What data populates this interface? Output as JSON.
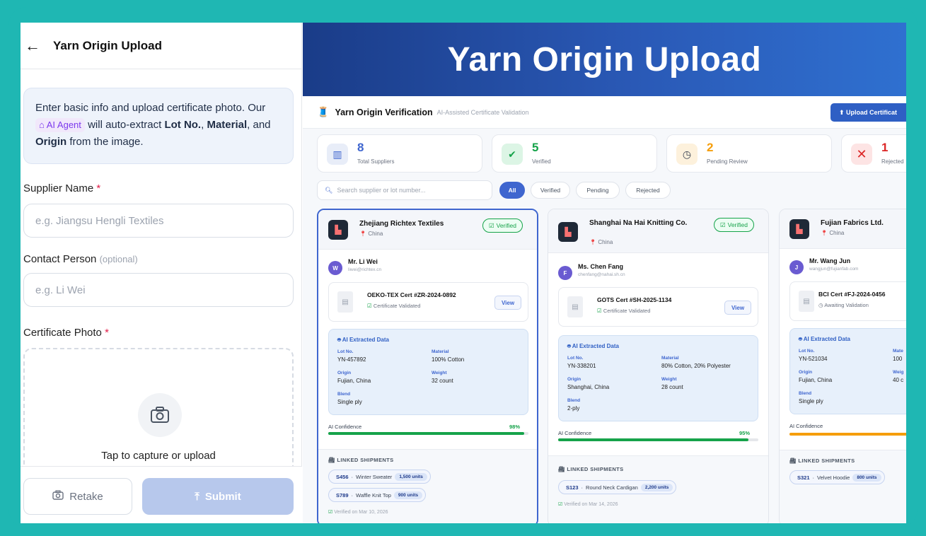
{
  "mobile": {
    "title": "Yarn Origin Upload",
    "info_part1": "Enter basic info and upload certificate photo. Our",
    "ai_agent": "AI Agent",
    "info_part2": "will auto-extract",
    "lot": "Lot No.",
    "material": "Material",
    "and": ", and",
    "origin": "Origin",
    "info_part3": "from the image.",
    "supplier_label": "Supplier Name",
    "supplier_placeholder": "e.g. Jiangsu Hengli Textiles",
    "contact_label": "Contact Person",
    "optional": "(optional)",
    "contact_placeholder": "e.g. Li Wei",
    "photo_label": "Certificate Photo",
    "upload_text": "Tap to capture or upload",
    "retake": "Retake",
    "submit": "Submit"
  },
  "banner": {
    "title": "Yarn Origin Upload"
  },
  "dashboard": {
    "title": "Yarn Origin Verification",
    "subtitle": "AI-Assisted Certificate Validation",
    "upload_button": "Upload Certificat",
    "stats": [
      {
        "value": "8",
        "label": "Total Suppliers",
        "color": "#3f66cf"
      },
      {
        "value": "5",
        "label": "Verified",
        "color": "#16a34a"
      },
      {
        "value": "2",
        "label": "Pending Review",
        "color": "#f59e0b"
      },
      {
        "value": "1",
        "label": "Rejected",
        "color": "#dc2626"
      }
    ],
    "search_placeholder": "Search supplier or lot number...",
    "filters": [
      "All",
      "Verified",
      "Pending",
      "Rejected"
    ],
    "cards": [
      {
        "name": "Zhejiang Richtex Textiles",
        "location": "China",
        "badge": "Verified",
        "initial": "W",
        "contact": "Mr. Li Wei",
        "email": "liwei@richtex.cn",
        "cert": "OEKO-TEX Cert #ZR-2024-0892",
        "cert_status": "Certificate Validated",
        "view": "View",
        "ai_title": "AI Extracted Data",
        "lot_k": "Lot No.",
        "lot": "YN-457892",
        "mat_k": "Material",
        "mat": "100% Cotton",
        "origin_k": "Origin",
        "origin": "Fujian, China",
        "weight_k": "Weight",
        "weight": "32 count",
        "blend_k": "Blend",
        "blend": "Single ply",
        "conf_label": "AI Confidence",
        "confidence": "98%",
        "confidence_value": 0.98,
        "ship_title": "LINKED SHIPMENTS",
        "shipments": [
          {
            "id": "S456",
            "desc": "Winter Sweater",
            "units": "1,500 units"
          },
          {
            "id": "S789",
            "desc": "Waffle Knit Top",
            "units": "900 units"
          }
        ],
        "verified_on": "Verified on Mar 10, 2026"
      },
      {
        "name": "Shanghai Na Hai Knitting Co.",
        "location": "China",
        "badge": "Verified",
        "initial": "F",
        "contact": "Ms. Chen Fang",
        "email": "chenfang@nahai.sh.cn",
        "cert": "GOTS Cert #SH-2025-1134",
        "cert_status": "Certificate Validated",
        "view": "View",
        "ai_title": "AI Extracted Data",
        "lot_k": "Lot No.",
        "lot": "YN-338201",
        "mat_k": "Material",
        "mat": "80% Cotton, 20% Polyester",
        "origin_k": "Origin",
        "origin": "Shanghai, China",
        "weight_k": "Weight",
        "weight": "28 count",
        "blend_k": "Blend",
        "blend": "2-ply",
        "conf_label": "AI Confidence",
        "confidence": "95%",
        "confidence_value": 0.95,
        "ship_title": "LINKED SHIPMENTS",
        "shipments": [
          {
            "id": "S123",
            "desc": "Round Neck Cardigan",
            "units": "2,200 units"
          }
        ],
        "verified_on": "Verified on Mar 14, 2026"
      },
      {
        "name": "Fujian Fabrics Ltd.",
        "location": "China",
        "initial": "J",
        "contact": "Mr. Wang Jun",
        "email": "wangjun@fujianfab.com",
        "cert": "BCI Cert #FJ-2024-0456",
        "cert_status": "Awaiting Validation",
        "ai_title": "AI Extracted Data",
        "lot_k": "Lot No.",
        "lot": "YN-521034",
        "mat_k": "Mate",
        "mat": "100",
        "origin_k": "Origin",
        "origin": "Fujian, China",
        "weight_k": "Weig",
        "weight": "40 c",
        "blend_k": "Blend",
        "blend": "Single ply",
        "conf_label": "AI Confidence",
        "confidence_value": 0.8,
        "ship_title": "LINKED SHIPMENTS",
        "shipments": [
          {
            "id": "S321",
            "desc": "Velvet Hoodie",
            "units": "800 units"
          }
        ]
      }
    ]
  },
  "colors": {
    "banner": "#2a59b6",
    "accent": "#3f66cf",
    "frame": "#1fb7b3",
    "verified": "#16a34a",
    "pending": "#f59e0b"
  }
}
